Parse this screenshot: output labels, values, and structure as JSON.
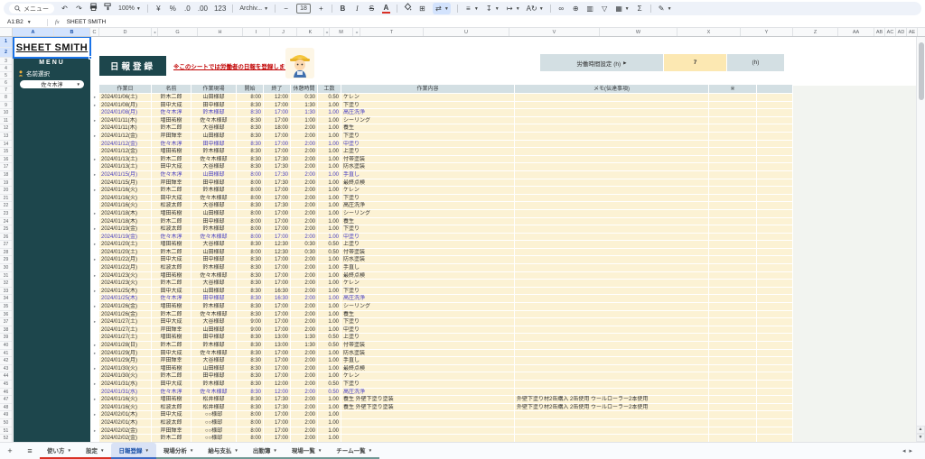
{
  "colors": {
    "sidebar_teal": "#1d464c",
    "header_blue": "#d3dfe3",
    "row_cream": "#fcf2d4",
    "value_yellow": "#fce8b2",
    "highlight_text": "#4a41c4",
    "selection_blue": "#1a73e8",
    "tab_red": "#d93025",
    "tab_teal": "#6f9894",
    "tab_active_blue": "#3c6ac4"
  },
  "toolbar": {
    "menu_label": "メニュー",
    "zoom_value": "100%",
    "currency_label": "¥",
    "percent_label": "%",
    "decimal_decrease_label": ".0",
    "decimal_increase_label": ".00",
    "more_formats_label": "123",
    "font_name": "Archiv...",
    "font_size_value": "18",
    "bold_label": "B",
    "italic_label": "I",
    "strike_label": "S",
    "text_color_label": "A",
    "functions_label": "Σ"
  },
  "formula_bar": {
    "name_box": "A1:B2",
    "fx_label": "fx",
    "formula": "SHEET SMITH"
  },
  "columns": [
    "A",
    "B",
    "C",
    "D",
    "|",
    "G",
    "H",
    "I",
    "J",
    "K",
    "|",
    "M",
    "|",
    "T",
    "U",
    "V",
    "W",
    "X",
    "Y",
    "Z",
    "AA",
    "AB",
    "AC",
    "AD",
    "AE"
  ],
  "sidebar": {
    "title": "SHEET SMITH",
    "menu_label": "MENU",
    "name_select_label": "名前選択",
    "name_select_value": "佐々木淳"
  },
  "header": {
    "page_title": "日報登録",
    "note": "※このシートでは労働者の日報を登録します。",
    "work_hours_label": "労働時間設定 (h)",
    "work_hours_arrow": "▶",
    "work_hours_value": "7",
    "work_hours_unit": "(h)"
  },
  "table": {
    "headers": [
      "作業日",
      "名前",
      "作業現場",
      "開始",
      "終了",
      "休憩時間",
      "工数",
      "作業内容",
      "メモ(伝達事項)",
      "※"
    ],
    "rows": [
      [
        "2024/01/06(土)",
        "鈴木二郎",
        "山田様邸",
        "8:00",
        "12:00",
        "0:30",
        "0.50",
        "ケレン",
        "",
        0
      ],
      [
        "2024/01/08(月)",
        "田中大成",
        "田中様邸",
        "8:30",
        "17:00",
        "1:30",
        "1.00",
        "下塗り",
        "",
        0
      ],
      [
        "2024/01/08(月)",
        "佐々木淳",
        "鈴木様邸",
        "8:30",
        "17:00",
        "1:30",
        "1.00",
        "高圧洗浄",
        "",
        1
      ],
      [
        "2024/01/11(木)",
        "増田祐樹",
        "佐々木様邸",
        "8:30",
        "17:00",
        "1:00",
        "1.00",
        "シーリング",
        "",
        0
      ],
      [
        "2024/01/11(木)",
        "鈴木二郎",
        "大谷様邸",
        "8:30",
        "18:00",
        "2:00",
        "1.00",
        "養生",
        "",
        0
      ],
      [
        "2024/01/12(金)",
        "岸田輝幸",
        "山田様邸",
        "8:30",
        "17:00",
        "2:00",
        "1.00",
        "下塗り",
        "",
        0
      ],
      [
        "2024/01/12(金)",
        "佐々木淳",
        "田中様邸",
        "8:30",
        "17:00",
        "2:00",
        "1.00",
        "中塗り",
        "",
        1
      ],
      [
        "2024/01/12(金)",
        "増田祐樹",
        "鈴木様邸",
        "8:30",
        "17:00",
        "2:00",
        "1.00",
        "上塗り",
        "",
        0
      ],
      [
        "2024/01/13(土)",
        "鈴木二郎",
        "佐々木様邸",
        "8:30",
        "17:30",
        "2:00",
        "1.00",
        "付帯塗装",
        "",
        0
      ],
      [
        "2024/01/13(土)",
        "田中大成",
        "大谷様邸",
        "8:30",
        "17:30",
        "2:00",
        "1.00",
        "防水塗装",
        "",
        0
      ],
      [
        "2024/01/15(月)",
        "佐々木淳",
        "山田様邸",
        "8:00",
        "17:30",
        "2:00",
        "1.00",
        "手直し",
        "",
        1
      ],
      [
        "2024/01/15(月)",
        "岸田輝幸",
        "田中様邸",
        "8:00",
        "17:30",
        "2:00",
        "1.00",
        "最終点検",
        "",
        0
      ],
      [
        "2024/01/16(火)",
        "鈴木二郎",
        "鈴木様邸",
        "8:00",
        "17:00",
        "2:00",
        "1.00",
        "ケレン",
        "",
        0
      ],
      [
        "2024/01/16(火)",
        "田中大成",
        "佐々木様邸",
        "8:00",
        "17:00",
        "2:00",
        "1.00",
        "下塗り",
        "",
        0
      ],
      [
        "2024/01/16(火)",
        "松波太郎",
        "大谷様邸",
        "8:30",
        "17:30",
        "2:00",
        "1.00",
        "高圧洗浄",
        "",
        0
      ],
      [
        "2024/01/18(木)",
        "増田祐樹",
        "山田様邸",
        "8:00",
        "17:00",
        "2:00",
        "1.00",
        "シーリング",
        "",
        0
      ],
      [
        "2024/01/18(木)",
        "鈴木二郎",
        "田中様邸",
        "8:00",
        "17:00",
        "2:00",
        "1.00",
        "養生",
        "",
        0
      ],
      [
        "2024/01/19(金)",
        "松波太郎",
        "鈴木様邸",
        "8:00",
        "17:00",
        "2:00",
        "1.00",
        "下塗り",
        "",
        0
      ],
      [
        "2024/01/19(金)",
        "佐々木淳",
        "佐々木様邸",
        "8:00",
        "17:00",
        "2:00",
        "1.00",
        "中塗り",
        "",
        1
      ],
      [
        "2024/01/20(土)",
        "増田祐樹",
        "大谷様邸",
        "8:30",
        "12:30",
        "0:30",
        "0.50",
        "上塗り",
        "",
        0
      ],
      [
        "2024/01/20(土)",
        "鈴木二郎",
        "山田様邸",
        "8:00",
        "12:30",
        "0:30",
        "0.50",
        "付帯塗装",
        "",
        0
      ],
      [
        "2024/01/22(月)",
        "田中大成",
        "田中様邸",
        "8:30",
        "17:00",
        "2:00",
        "1.00",
        "防水塗装",
        "",
        0
      ],
      [
        "2024/01/22(月)",
        "松波太郎",
        "鈴木様邸",
        "8:30",
        "17:00",
        "2:00",
        "1.00",
        "手直し",
        "",
        0
      ],
      [
        "2024/01/23(火)",
        "増田祐樹",
        "佐々木様邸",
        "8:30",
        "17:00",
        "2:00",
        "1.00",
        "最終点検",
        "",
        0
      ],
      [
        "2024/01/23(火)",
        "鈴木二郎",
        "大谷様邸",
        "8:30",
        "17:00",
        "2:00",
        "1.00",
        "ケレン",
        "",
        0
      ],
      [
        "2024/01/25(木)",
        "田中大成",
        "山田様邸",
        "8:30",
        "16:30",
        "2:00",
        "1.00",
        "下塗り",
        "",
        0
      ],
      [
        "2024/01/25(木)",
        "佐々木淳",
        "田中様邸",
        "8:30",
        "16:30",
        "2:00",
        "1.00",
        "高圧洗浄",
        "",
        1
      ],
      [
        "2024/01/26(金)",
        "増田祐樹",
        "鈴木様邸",
        "8:30",
        "17:00",
        "2:00",
        "1.00",
        "シーリング",
        "",
        0
      ],
      [
        "2024/01/26(金)",
        "鈴木二郎",
        "佐々木様邸",
        "8:30",
        "17:00",
        "2:00",
        "1.00",
        "養生",
        "",
        0
      ],
      [
        "2024/01/27(土)",
        "田中大成",
        "大谷様邸",
        "9:00",
        "17:00",
        "2:00",
        "1.00",
        "下塗り",
        "",
        0
      ],
      [
        "2024/01/27(土)",
        "岸田輝幸",
        "山田様邸",
        "9:00",
        "17:00",
        "2:00",
        "1.00",
        "中塗り",
        "",
        0
      ],
      [
        "2024/01/27(土)",
        "増田祐樹",
        "田中様邸",
        "8:30",
        "13:00",
        "1:30",
        "0.50",
        "上塗り",
        "",
        0
      ],
      [
        "2024/01/28(日)",
        "鈴木二郎",
        "鈴木様邸",
        "8:30",
        "13:00",
        "1:30",
        "0.50",
        "付帯塗装",
        "",
        0
      ],
      [
        "2024/01/29(月)",
        "田中大成",
        "佐々木様邸",
        "8:30",
        "17:00",
        "2:00",
        "1.00",
        "防水塗装",
        "",
        0
      ],
      [
        "2024/01/29(月)",
        "岸田輝幸",
        "大谷様邸",
        "8:30",
        "17:00",
        "2:00",
        "1.00",
        "手直し",
        "",
        0
      ],
      [
        "2024/01/30(火)",
        "増田祐樹",
        "山田様邸",
        "8:30",
        "17:00",
        "2:00",
        "1.00",
        "最終点検",
        "",
        0
      ],
      [
        "2024/01/30(火)",
        "鈴木二郎",
        "田中様邸",
        "8:30",
        "17:00",
        "2:00",
        "1.00",
        "ケレン",
        "",
        0
      ],
      [
        "2024/01/31(水)",
        "田中大成",
        "鈴木様邸",
        "8:30",
        "12:00",
        "2:00",
        "0.50",
        "下塗り",
        "",
        0
      ],
      [
        "2024/01/31(水)",
        "佐々木淳",
        "佐々木様邸",
        "8:30",
        "12:00",
        "2:00",
        "0.50",
        "高圧洗浄",
        "",
        1
      ],
      [
        "2024/01/16(火)",
        "増田祐樹",
        "松井様邸",
        "8:30",
        "17:30",
        "2:00",
        "1.00",
        "養生 外壁下塗り塗装",
        "外壁下塗り材2缶購入 2缶使用 ウールローラー2本使用",
        0
      ],
      [
        "2024/01/16(火)",
        "松波太郎",
        "松井様邸",
        "8:30",
        "17:30",
        "2:00",
        "1.00",
        "養生 外壁下塗り塗装",
        "外壁下塗り材2缶購入 2缶使用 ウールローラー2本使用",
        0
      ],
      [
        "2024/02/01(木)",
        "田中大成",
        "○○様邸",
        "8:00",
        "17:00",
        "2:00",
        "1.00",
        "",
        "",
        0
      ],
      [
        "2024/02/01(木)",
        "松波太郎",
        "○○様邸",
        "8:00",
        "17:00",
        "2:00",
        "1.00",
        "",
        "",
        0
      ],
      [
        "2024/02/02(金)",
        "岸田輝幸",
        "○○様邸",
        "8:00",
        "17:00",
        "2:00",
        "1.00",
        "",
        "",
        0
      ],
      [
        "2024/02/02(金)",
        "鈴木二郎",
        "○○様邸",
        "8:00",
        "17:00",
        "2:00",
        "1.00",
        "",
        "",
        0
      ]
    ]
  },
  "tabs": {
    "add_label": "+",
    "all_sheets_label": "≡",
    "items": [
      {
        "label": "使い方",
        "color": "#d93025",
        "active": false
      },
      {
        "label": "設定",
        "color": "#d93025",
        "active": false
      },
      {
        "label": "日報登録",
        "color": "#3c6ac4",
        "active": true
      },
      {
        "label": "現場分析",
        "color": "#6f9894",
        "active": false
      },
      {
        "label": "給与支払",
        "color": "#6f9894",
        "active": false
      },
      {
        "label": "出勤簿",
        "color": "#6f9894",
        "active": false
      },
      {
        "label": "現場一覧",
        "color": "#6f9894",
        "active": false
      },
      {
        "label": "チーム一覧",
        "color": "#6f9894",
        "active": false
      }
    ]
  }
}
